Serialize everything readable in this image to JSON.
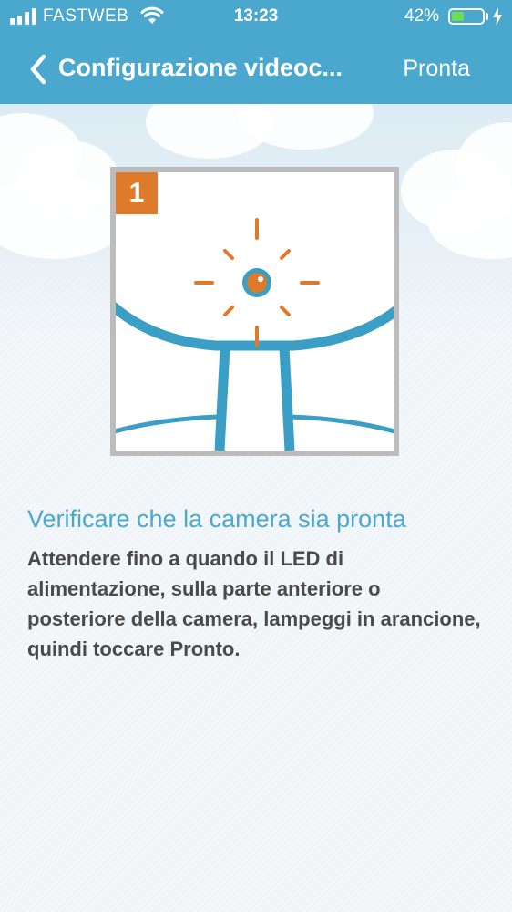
{
  "status_bar": {
    "carrier": "FASTWEB",
    "time": "13:23",
    "battery_percent": "42%",
    "battery_level": 0.42,
    "signal_bars": 4,
    "battery_color": "#6fdc58"
  },
  "nav": {
    "back_icon": "chevron-left-icon",
    "title": "Configurazione videoc...",
    "action_label": "Pronta"
  },
  "step": {
    "number": "1",
    "heading": "Verificare che la camera sia pronta",
    "description": "Attendere fino a quando il LED di alimentazione, sulla parte anteriore o posteriore della camera, lampeggi in arancione, quindi toccare Pronto."
  },
  "colors": {
    "accent": "#4aa8cf",
    "led_orange": "#e07a2b",
    "text_dark": "#4a4a4a"
  }
}
